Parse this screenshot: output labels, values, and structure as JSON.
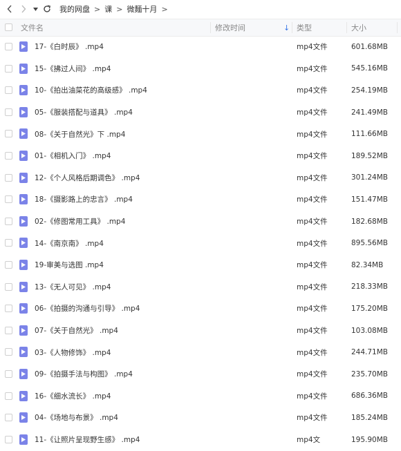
{
  "breadcrumb": [
    "我的网盘",
    "课",
    "微麵十月"
  ],
  "breadcrumb_separator": ">",
  "columns": {
    "name": "文件名",
    "modified": "修改时间",
    "type": "类型",
    "size": "大小",
    "sort_indicator": "↓"
  },
  "accent_color": "#7b83e8",
  "files": [
    {
      "name": "17-《白时辰》 .mp4",
      "type": "mp4文件",
      "size": "601.68MB"
    },
    {
      "name": "15-《拂过人间》 .mp4",
      "type": "mp4文件",
      "size": "545.16MB"
    },
    {
      "name": "10-《拍出油菜花的高级感》 .mp4",
      "type": "mp4文件",
      "size": "254.19MB"
    },
    {
      "name": "05-《服装搭配与道具》 .mp4",
      "type": "mp4文件",
      "size": "241.49MB"
    },
    {
      "name": "08-《关于自然光》下 .mp4",
      "type": "mp4文件",
      "size": "111.66MB"
    },
    {
      "name": "01-《相机入门》 .mp4",
      "type": "mp4文件",
      "size": "189.52MB"
    },
    {
      "name": "12-《个人风格后期调色》 .mp4",
      "type": "mp4文件",
      "size": "301.24MB"
    },
    {
      "name": "18-《摄影路上的忠言》 .mp4",
      "type": "mp4文件",
      "size": "151.47MB"
    },
    {
      "name": "02-《修图常用工具》 .mp4",
      "type": "mp4文件",
      "size": "182.68MB"
    },
    {
      "name": "14-《南京南》 .mp4",
      "type": "mp4文件",
      "size": "895.56MB"
    },
    {
      "name": "19-审美与选图 .mp4",
      "type": "mp4文件",
      "size": "82.34MB"
    },
    {
      "name": "13-《无人可见》 .mp4",
      "type": "mp4文件",
      "size": "218.33MB"
    },
    {
      "name": "06-《拍摄的沟通与引导》 .mp4",
      "type": "mp4文件",
      "size": "175.20MB"
    },
    {
      "name": "07-《关于自然光》 .mp4",
      "type": "mp4文件",
      "size": "103.08MB"
    },
    {
      "name": "03-《人物修饰》 .mp4",
      "type": "mp4文件",
      "size": "244.71MB"
    },
    {
      "name": "09-《拍摄手法与构图》 .mp4",
      "type": "mp4文件",
      "size": "235.70MB"
    },
    {
      "name": "16-《细水流长》 .mp4",
      "type": "mp4文件",
      "size": "686.36MB"
    },
    {
      "name": "04-《场地与布景》 .mp4",
      "type": "mp4文件",
      "size": "185.24MB"
    },
    {
      "name": "11-《让照片呈现野生感》 .mp4",
      "type": "mp4文",
      "size": "195.90MB"
    }
  ]
}
